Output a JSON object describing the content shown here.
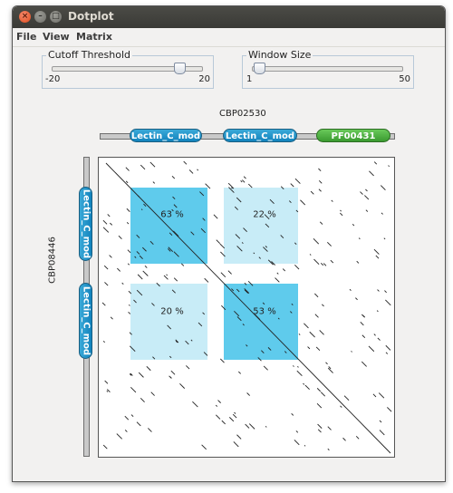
{
  "window": {
    "title": "Dotplot"
  },
  "menu": {
    "file": "File",
    "view": "View",
    "matrix": "Matrix"
  },
  "cutoff": {
    "label": "Cutoff Threshold",
    "min": "-20",
    "max": "20",
    "value": 14
  },
  "window_size": {
    "label": "Window Size",
    "min": "1",
    "max": "50",
    "value": 3
  },
  "horizontal_sequence": {
    "name": "CBP02530",
    "domains": [
      "Lectin_C_mod",
      "Lectin_C_mod",
      "PF00431"
    ]
  },
  "vertical_sequence": {
    "name": "CBP08446",
    "domains": [
      "Lectin_C_mod",
      "Lectin_C_mod"
    ]
  },
  "cells": [
    {
      "label": "63 %",
      "value": 63
    },
    {
      "label": "22 %",
      "value": 22
    },
    {
      "label": "20 %",
      "value": 20
    },
    {
      "label": "53 %",
      "value": 53
    }
  ],
  "colors": {
    "high_identity": "#5fcbec",
    "low_identity": "#c8ecf7",
    "domain_blue": "#1a8ac3",
    "domain_green": "#4fae42"
  }
}
